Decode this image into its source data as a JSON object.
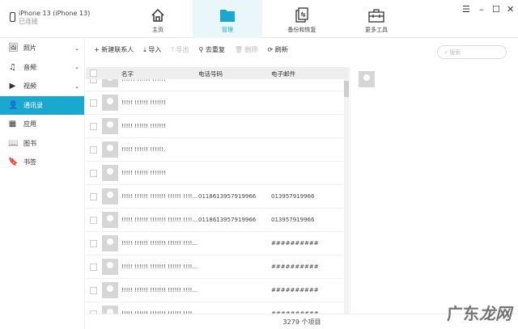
{
  "device": {
    "name": "iPhone 13 (iPhone 13)",
    "status": "已连接"
  },
  "nav": [
    {
      "label": "主页"
    },
    {
      "label": "管理"
    },
    {
      "label": "备份和恢复"
    },
    {
      "label": "更多工具"
    }
  ],
  "window": {
    "menu": "☰",
    "min": "–",
    "max": "☐",
    "close": "✕"
  },
  "sidebar": [
    {
      "label": "照片",
      "icon": "🖼"
    },
    {
      "label": "音频",
      "icon": "♫"
    },
    {
      "label": "视频",
      "icon": "▶"
    },
    {
      "label": "通讯录",
      "icon": "👤"
    },
    {
      "label": "应用",
      "icon": "▦"
    },
    {
      "label": "图书",
      "icon": "📖"
    },
    {
      "label": "书签",
      "icon": "🔖"
    }
  ],
  "toolbar": {
    "new": "+ 新建联系人",
    "import": "⤓ 导入",
    "export": "⤒ 导出",
    "dedupe": "⚲ 去重复",
    "delete": "🗑 删除",
    "refresh": "⟳ 刷新"
  },
  "search": {
    "placeholder": "⌕ 搜索"
  },
  "table": {
    "headers": [
      "名字",
      "电话号码",
      "电子邮件"
    ],
    "rows": [
      {
        "name": "!!!!!! !!!!!! !!!!!!",
        "phone": "",
        "email": ""
      },
      {
        "name": "!!!!! !!!!!! !!!!!!!",
        "phone": "",
        "email": ""
      },
      {
        "name": "!!!!! !!!!!! !!!!!!!",
        "phone": "",
        "email": ""
      },
      {
        "name": "!!!!! !!!!!! !!!!!!.",
        "phone": "",
        "email": ""
      },
      {
        "name": "!!!!! !!!!!! !!!!!!!",
        "phone": "",
        "email": ""
      },
      {
        "name": "!!!!! !!!!!! !!!!!!! !!!!!! !!!!...",
        "phone": "0118613957919966",
        "email": "013957919966"
      },
      {
        "name": "!!!!! !!!!!! !!!!!!! !!!!!! !!!!...",
        "phone": "0118613957919966",
        "email": "013957919966"
      },
      {
        "name": "!!!!! !!!!!! !!!!!!! !!!!!! !!!!...",
        "phone": "",
        "email": "##########"
      },
      {
        "name": "!!!!! !!!!!! !!!!!!! !!!!!! !!!!...",
        "phone": "",
        "email": "##########"
      },
      {
        "name": "!!!!! !!!!!! !!!!!!! !!!!!! !!!!...",
        "phone": "",
        "email": "##########"
      },
      {
        "name": "!!!!! !!!!!! !!!!!!! !!!!!! !!!!",
        "phone": "",
        "email": "##########"
      }
    ]
  },
  "footer": {
    "count": "3279 个项目"
  },
  "watermark": "广东龙网"
}
